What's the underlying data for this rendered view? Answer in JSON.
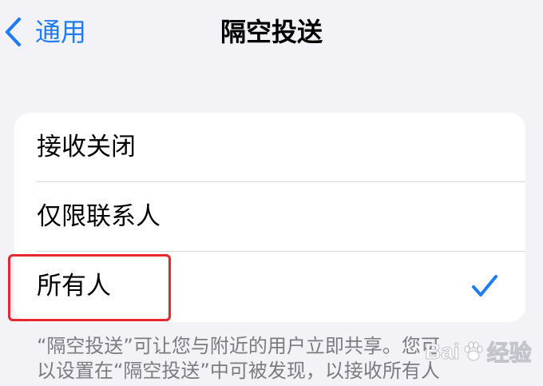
{
  "nav": {
    "back_label": "通用",
    "title": "隔空投送"
  },
  "options": [
    {
      "label": "接收关闭",
      "selected": false
    },
    {
      "label": "仅限联系人",
      "selected": false
    },
    {
      "label": "所有人",
      "selected": true
    }
  ],
  "footer": {
    "line1": "“隔空投送”可让您与附近的用户立即共享。您可",
    "line2": "以设置在“隔空投送”中可被发现，以接收所有人"
  },
  "watermark": {
    "left": "Bai",
    "right": "经验"
  },
  "colors": {
    "accent": "#1f7bf6",
    "highlight": "#e8262d",
    "background": "#f2f2f7",
    "card": "#ffffff",
    "secondary_text": "#7b7b80"
  },
  "icons": {
    "back": "chevron-left-icon",
    "selected": "checkmark-icon",
    "watermark": "paw-icon"
  }
}
